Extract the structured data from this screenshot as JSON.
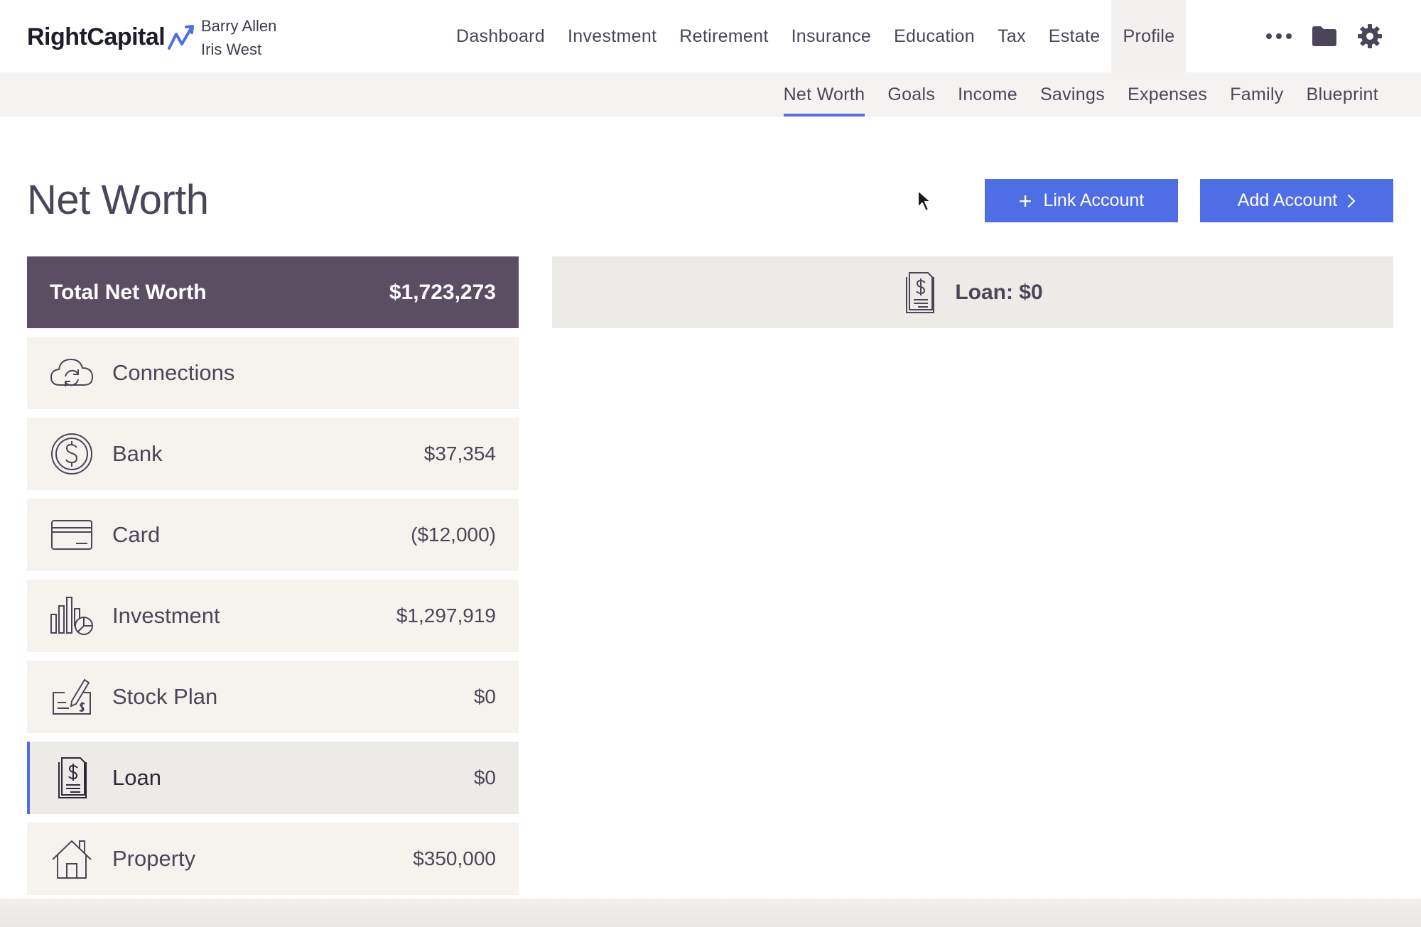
{
  "brand": {
    "name": "RightCapital"
  },
  "clients": [
    "Barry Allen",
    "Iris West"
  ],
  "main_nav": [
    {
      "label": "Dashboard",
      "active": false
    },
    {
      "label": "Investment",
      "active": false
    },
    {
      "label": "Retirement",
      "active": false
    },
    {
      "label": "Insurance",
      "active": false
    },
    {
      "label": "Education",
      "active": false
    },
    {
      "label": "Tax",
      "active": false
    },
    {
      "label": "Estate",
      "active": false
    },
    {
      "label": "Profile",
      "active": true
    }
  ],
  "top_icons": [
    "more-icon",
    "folder-icon",
    "gear-icon"
  ],
  "sub_nav": [
    {
      "label": "Net Worth",
      "active": true
    },
    {
      "label": "Goals",
      "active": false
    },
    {
      "label": "Income",
      "active": false
    },
    {
      "label": "Savings",
      "active": false
    },
    {
      "label": "Expenses",
      "active": false
    },
    {
      "label": "Family",
      "active": false
    },
    {
      "label": "Blueprint",
      "active": false
    }
  ],
  "page": {
    "title": "Net Worth",
    "link_account_label": "Link Account",
    "add_account_label": "Add Account"
  },
  "summary": {
    "label": "Total Net Worth",
    "value": "$1,723,273"
  },
  "categories": [
    {
      "label": "Connections",
      "value": "",
      "icon": "cloud-sync-icon",
      "selected": false
    },
    {
      "label": "Bank",
      "value": "$37,354",
      "icon": "dollar-coin-icon",
      "selected": false
    },
    {
      "label": "Card",
      "value": "($12,000)",
      "icon": "credit-card-icon",
      "selected": false
    },
    {
      "label": "Investment",
      "value": "$1,297,919",
      "icon": "investment-chart-icon",
      "selected": false
    },
    {
      "label": "Stock Plan",
      "value": "$0",
      "icon": "stock-plan-check-icon",
      "selected": false
    },
    {
      "label": "Loan",
      "value": "$0",
      "icon": "loan-document-icon",
      "selected": true
    },
    {
      "label": "Property",
      "value": "$350,000",
      "icon": "house-icon",
      "selected": false
    }
  ],
  "detail": {
    "title": "Loan: $0",
    "icon": "loan-document-icon"
  },
  "colors": {
    "accent": "#4f6ee6",
    "summary_bg": "#5b4e63",
    "text": "#4b4558",
    "row_bg": "#f6f3ef"
  }
}
